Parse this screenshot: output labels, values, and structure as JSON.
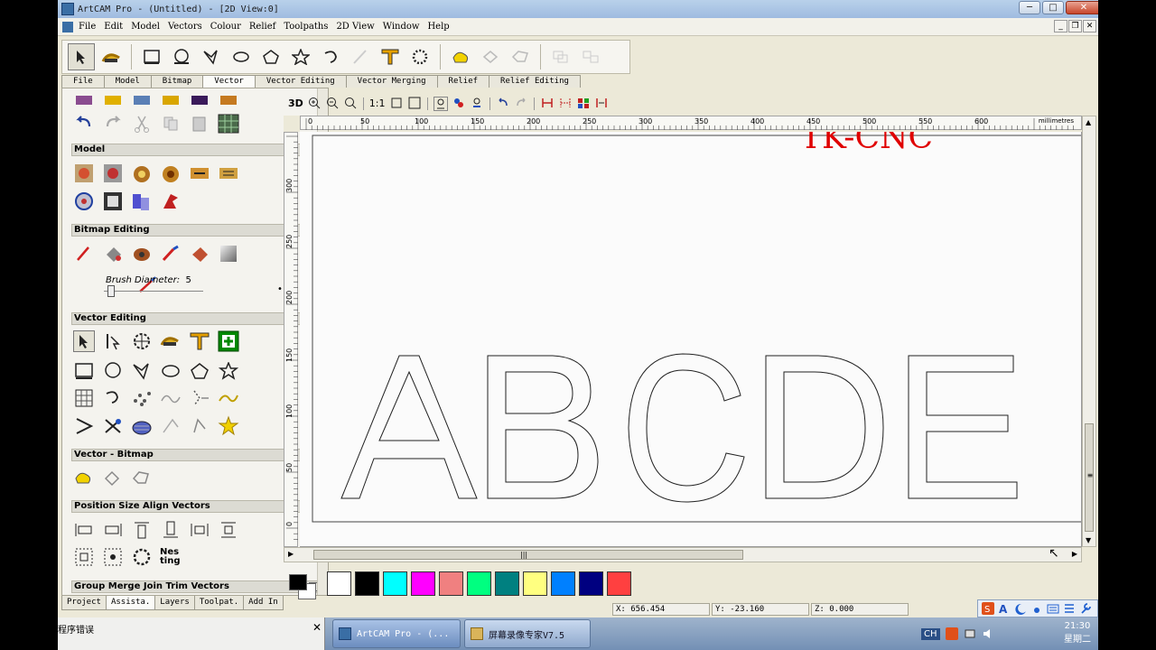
{
  "window": {
    "title": "ArtCAM Pro - (Untitled) - [2D View:0]",
    "btn_min": "─",
    "btn_max": "□",
    "btn_close": "✕"
  },
  "menu": {
    "items": [
      "File",
      "Edit",
      "Model",
      "Vectors",
      "Colour",
      "Relief",
      "Toolpaths",
      "2D View",
      "Window",
      "Help"
    ],
    "mdi_min": "_",
    "mdi_restore": "❐",
    "mdi_close": "✕"
  },
  "tabs": [
    "File",
    "Model",
    "Bitmap",
    "Vector",
    "Vector Editing",
    "Vector Merging",
    "Relief",
    "Relief Editing"
  ],
  "active_tab": "Vector",
  "panel": {
    "sections": [
      {
        "title": "Model"
      },
      {
        "title": "Bitmap Editing"
      },
      {
        "title": "Vector Editing"
      },
      {
        "title": "Vector - Bitmap"
      },
      {
        "title": "Position Size Align Vectors"
      },
      {
        "title": "Group Merge Join Trim Vectors"
      }
    ],
    "brush_label": "Brush Diameter:",
    "brush_value": "5",
    "nesting_text": "Nes ting"
  },
  "bottom_tabs": [
    "Project",
    "Assista.",
    "Layers",
    "Toolpat.",
    "Add In"
  ],
  "active_bottom_tab": "Assista.",
  "view_toolbar": {
    "label_3d": "3D",
    "label_11": "1:1"
  },
  "ruler": {
    "top_labels": [
      "0",
      "50",
      "100",
      "150",
      "200",
      "250",
      "300",
      "350",
      "400",
      "450",
      "500",
      "550",
      "600"
    ],
    "left_labels": [
      "300",
      "250",
      "200",
      "150",
      "100",
      "50",
      "0"
    ],
    "unit": "millimetres",
    "scroll_grip": "≡",
    "h_grip": "|||"
  },
  "canvas": {
    "letters": [
      "A",
      "B",
      "C",
      "D",
      "E"
    ],
    "overlay_text": "TK-CNC",
    "overlay_color": "#e00000"
  },
  "palette": {
    "colors": [
      "#ffffff",
      "#000000",
      "#00ffff",
      "#ff00ff",
      "#f08080",
      "#00ff80",
      "#008080",
      "#ffff80",
      "#0080ff",
      "#000080",
      "#ff4040"
    ]
  },
  "status": {
    "x": "X: 656.454",
    "y": "Y: -23.160",
    "z": "Z: 0.000"
  },
  "taskbar": {
    "left_text": "程序错误",
    "close_label": "✕",
    "tasks": [
      {
        "label": "ArtCAM Pro - (...",
        "active": true
      },
      {
        "label": "屏幕录像专家V7.5",
        "active": false
      }
    ],
    "tray_ch": "CH",
    "clock_time": "21:30",
    "clock_day": "星期二"
  }
}
